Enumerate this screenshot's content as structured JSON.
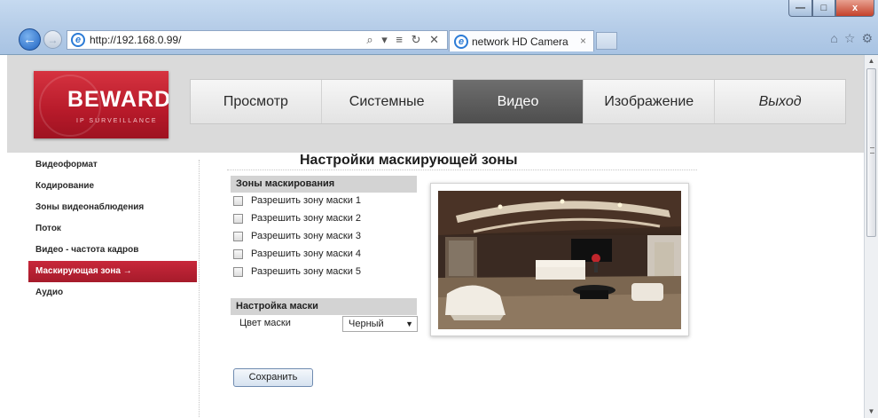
{
  "browser": {
    "url": "http://192.168.0.99/",
    "address_tools": "⌕ ▾ ≡ ↻ ✕",
    "tab_title": "network HD Camera",
    "tab_close": "×",
    "ie_glyph": "e",
    "back_glyph": "←",
    "forward_glyph": "→",
    "home_glyph": "⌂",
    "star_glyph": "☆",
    "gear_glyph": "⚙",
    "minimize_glyph": "—",
    "maximize_glyph": "□",
    "close_glyph": "x",
    "scroll_up_glyph": "▲",
    "scroll_down_glyph": "▼"
  },
  "logo": {
    "brand": "BEWARD",
    "subtitle": "IP SURVEILLANCE"
  },
  "menu": {
    "items": [
      {
        "label": "Просмотр"
      },
      {
        "label": "Системные"
      },
      {
        "label": "Видео"
      },
      {
        "label": "Изображение"
      },
      {
        "label": "Выход"
      }
    ],
    "active_index": 2
  },
  "sidebar": {
    "items": [
      {
        "label": "Видеоформат"
      },
      {
        "label": "Кодирование"
      },
      {
        "label": "Зоны видеонаблюдения"
      },
      {
        "label": "Поток"
      },
      {
        "label": "Видео - частота кадров"
      },
      {
        "label": "Маскирующая зона →"
      },
      {
        "label": "Аудио"
      }
    ],
    "active_index": 5
  },
  "main": {
    "title": "Настройки маскирующей зоны",
    "masks_section": {
      "heading": "Зоны маскирования",
      "items": [
        {
          "label": "Разрешить зону маски 1",
          "checked": false
        },
        {
          "label": "Разрешить зону маски 2",
          "checked": false
        },
        {
          "label": "Разрешить зону маски 3",
          "checked": false
        },
        {
          "label": "Разрешить зону маски 4",
          "checked": false
        },
        {
          "label": "Разрешить зону маски 5",
          "checked": false
        }
      ]
    },
    "mask_settings": {
      "heading": "Настройка маски",
      "color_label": "Цвет маски",
      "color_value": "Черный",
      "select_arrow": "▼"
    },
    "save_label": "Сохранить"
  },
  "colors": {
    "brand_red": "#b71a2a",
    "active_menu": "#5c5c5c",
    "header_band": "#dadada",
    "section_head": "#d3d3d3"
  }
}
